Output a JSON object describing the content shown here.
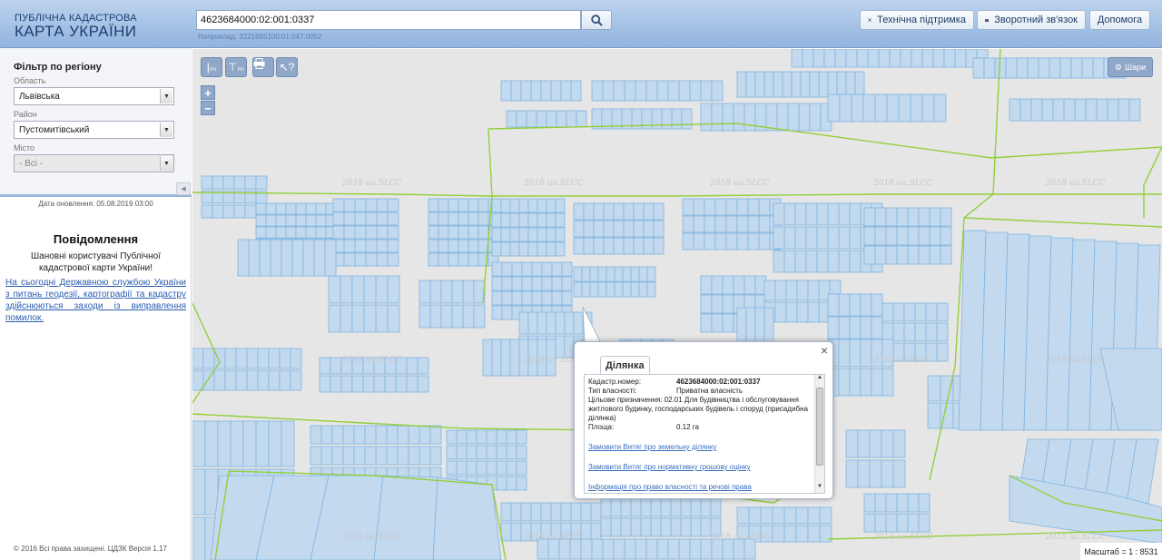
{
  "header": {
    "logo_line1": "ПУБЛІЧНА КАДАСТРОВА",
    "logo_line2": "КАРТА УКРАЇНИ",
    "search_value": "4623684000:02:001:0337",
    "search_hint": "Наприклад: 3221655100:01:047:0052",
    "buttons": {
      "support": "Технічна підтримка",
      "feedback": "Зворотний зв'язок",
      "help": "Допомога"
    }
  },
  "sidebar": {
    "filter_title": "Фільтр по регіону",
    "region_label": "Область",
    "region_value": "Львівська",
    "district_label": "Район",
    "district_value": "Пустомитівський",
    "city_label": "Місто",
    "city_value": "- Всі -",
    "updated": "Дата оновлення: 05.08.2019 03:00",
    "notice_title": "Повідомлення",
    "notice_text": "Шановні користувачі Публічної кадастрової карти України!",
    "notice_link": "На сьогодні Державною службою України з питань геодезії, картографії та кадастру здійснюються заходи із виправлення помилок.",
    "copyright": "© 2016 Всі права захищені. ЦДЗК Версія 1.17"
  },
  "map": {
    "tools": [
      "measure-length",
      "measure-area",
      "print",
      "identify"
    ],
    "zoom_in": "+",
    "zoom_out": "−",
    "layers_label": "Шари",
    "watermark": "2018 ua.SLCC",
    "scale": "Масштаб = 1 : 8531",
    "popup": {
      "tab": "Ділянка",
      "rows": [
        {
          "label": "Кадастр.номер:",
          "value": "4623684000:02:001:0337"
        },
        {
          "label": "Тип власності:",
          "value": "Приватна власність"
        },
        {
          "label": "Цільове призначення:",
          "value": "02.01 Для будівництва і обслуговування житлового будинку, господарських будівель і споруд (присадибна ділянка)"
        },
        {
          "label": "Площа:",
          "value": "0.12 га"
        }
      ],
      "links": [
        "Замовити Витяг про земельну ділянку",
        "Замовити Витяг про нормативну грошову оцінку",
        "Інформація про право власності та речові права"
      ]
    }
  }
}
